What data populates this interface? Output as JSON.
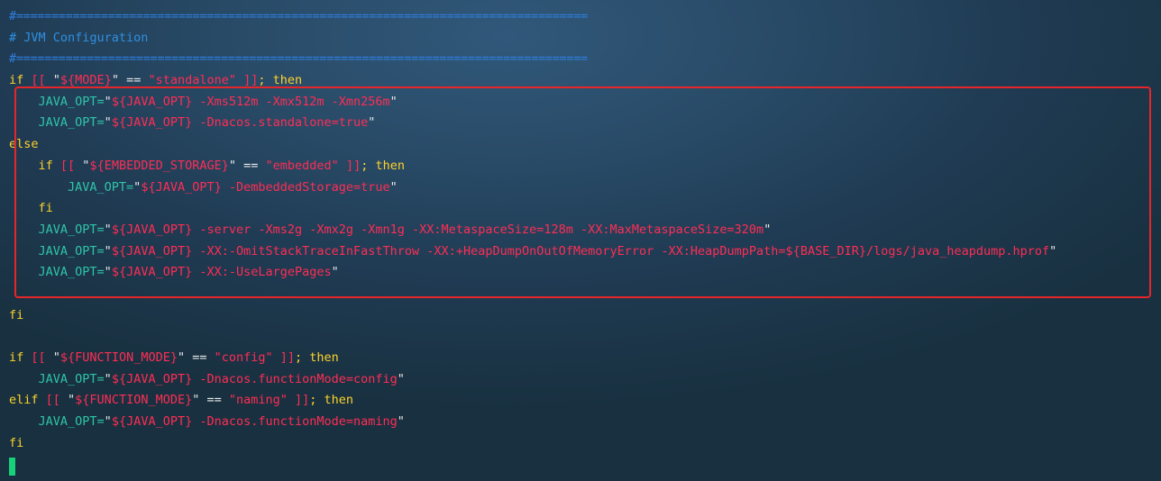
{
  "terminal": {
    "lines": [
      {
        "segments": [
          {
            "t": "#=================================================================================",
            "c": "sep"
          }
        ]
      },
      {
        "segments": [
          {
            "t": "# JVM Configuration",
            "c": "comment"
          }
        ]
      },
      {
        "segments": [
          {
            "t": "#=================================================================================",
            "c": "sep"
          }
        ]
      },
      {
        "segments": [
          {
            "t": "if ",
            "c": "kw"
          },
          {
            "t": "[[ ",
            "c": "bracket"
          },
          {
            "t": "\"",
            "c": "op"
          },
          {
            "t": "${MODE}",
            "c": "str"
          },
          {
            "t": "\" ",
            "c": "op"
          },
          {
            "t": "== ",
            "c": "op"
          },
          {
            "t": "\"standalone\" ",
            "c": "str"
          },
          {
            "t": "]]",
            "c": "bracket"
          },
          {
            "t": "; then",
            "c": "kw"
          }
        ]
      },
      {
        "segments": [
          {
            "t": "    JAVA_OPT=",
            "c": "var"
          },
          {
            "t": "\"",
            "c": "op"
          },
          {
            "t": "${JAVA_OPT} -Xms512m -Xmx512m -Xmn256m",
            "c": "str"
          },
          {
            "t": "\"",
            "c": "op"
          }
        ]
      },
      {
        "segments": [
          {
            "t": "    JAVA_OPT=",
            "c": "var"
          },
          {
            "t": "\"",
            "c": "op"
          },
          {
            "t": "${JAVA_OPT} -Dnacos.standalone=true",
            "c": "str"
          },
          {
            "t": "\"",
            "c": "op"
          }
        ]
      },
      {
        "segments": [
          {
            "t": "else",
            "c": "kw"
          }
        ]
      },
      {
        "segments": [
          {
            "t": "    if ",
            "c": "kw"
          },
          {
            "t": "[[ ",
            "c": "bracket"
          },
          {
            "t": "\"",
            "c": "op"
          },
          {
            "t": "${EMBEDDED_STORAGE}",
            "c": "str"
          },
          {
            "t": "\" ",
            "c": "op"
          },
          {
            "t": "== ",
            "c": "op"
          },
          {
            "t": "\"embedded\" ",
            "c": "str"
          },
          {
            "t": "]]",
            "c": "bracket"
          },
          {
            "t": "; then",
            "c": "kw"
          }
        ]
      },
      {
        "segments": [
          {
            "t": "        JAVA_OPT=",
            "c": "var"
          },
          {
            "t": "\"",
            "c": "op"
          },
          {
            "t": "${JAVA_OPT} -DembeddedStorage=true",
            "c": "str"
          },
          {
            "t": "\"",
            "c": "op"
          }
        ]
      },
      {
        "segments": [
          {
            "t": "    fi",
            "c": "kw"
          }
        ]
      },
      {
        "segments": [
          {
            "t": "    JAVA_OPT=",
            "c": "var"
          },
          {
            "t": "\"",
            "c": "op"
          },
          {
            "t": "${JAVA_OPT} -server -Xms2g -Xmx2g -Xmn1g -XX:MetaspaceSize=128m -XX:MaxMetaspaceSize=320m",
            "c": "str"
          },
          {
            "t": "\"",
            "c": "op"
          }
        ]
      },
      {
        "segments": [
          {
            "t": "    JAVA_OPT=",
            "c": "var"
          },
          {
            "t": "\"",
            "c": "op"
          },
          {
            "t": "${JAVA_OPT} -XX:-OmitStackTraceInFastThrow -XX:+HeapDumpOnOutOfMemoryError -XX:HeapDumpPath=${BASE_DIR}/logs/java_heapdump.hprof",
            "c": "str"
          },
          {
            "t": "\"",
            "c": "op"
          }
        ]
      },
      {
        "segments": [
          {
            "t": "    JAVA_OPT=",
            "c": "var"
          },
          {
            "t": "\"",
            "c": "op"
          },
          {
            "t": "${JAVA_OPT} -XX:-UseLargePages",
            "c": "str"
          },
          {
            "t": "\"",
            "c": "op"
          }
        ]
      },
      {
        "segments": []
      },
      {
        "segments": [
          {
            "t": "fi",
            "c": "kw"
          }
        ]
      },
      {
        "segments": []
      },
      {
        "segments": [
          {
            "t": "if ",
            "c": "kw"
          },
          {
            "t": "[[ ",
            "c": "bracket"
          },
          {
            "t": "\"",
            "c": "op"
          },
          {
            "t": "${FUNCTION_MODE}",
            "c": "str"
          },
          {
            "t": "\" ",
            "c": "op"
          },
          {
            "t": "== ",
            "c": "op"
          },
          {
            "t": "\"config\" ",
            "c": "str"
          },
          {
            "t": "]]",
            "c": "bracket"
          },
          {
            "t": "; then",
            "c": "kw"
          }
        ]
      },
      {
        "segments": [
          {
            "t": "    JAVA_OPT=",
            "c": "var"
          },
          {
            "t": "\"",
            "c": "op"
          },
          {
            "t": "${JAVA_OPT} -Dnacos.functionMode=config",
            "c": "str"
          },
          {
            "t": "\"",
            "c": "op"
          }
        ]
      },
      {
        "segments": [
          {
            "t": "elif ",
            "c": "kw"
          },
          {
            "t": "[[ ",
            "c": "bracket"
          },
          {
            "t": "\"",
            "c": "op"
          },
          {
            "t": "${FUNCTION_MODE}",
            "c": "str"
          },
          {
            "t": "\" ",
            "c": "op"
          },
          {
            "t": "== ",
            "c": "op"
          },
          {
            "t": "\"naming\" ",
            "c": "str"
          },
          {
            "t": "]]",
            "c": "bracket"
          },
          {
            "t": "; then",
            "c": "kw"
          }
        ]
      },
      {
        "segments": [
          {
            "t": "    JAVA_OPT=",
            "c": "var"
          },
          {
            "t": "\"",
            "c": "op"
          },
          {
            "t": "${JAVA_OPT} -Dnacos.functionMode=naming",
            "c": "str"
          },
          {
            "t": "\"",
            "c": "op"
          }
        ]
      },
      {
        "segments": [
          {
            "t": "fi",
            "c": "kw"
          }
        ]
      }
    ]
  },
  "colors": {
    "keyword": "#ffd32a",
    "variable": "#2fc4a8",
    "string": "#ff2d55",
    "comment": "#2f8fe0",
    "cursor": "#16d27a",
    "highlight_box": "#e5262a"
  }
}
